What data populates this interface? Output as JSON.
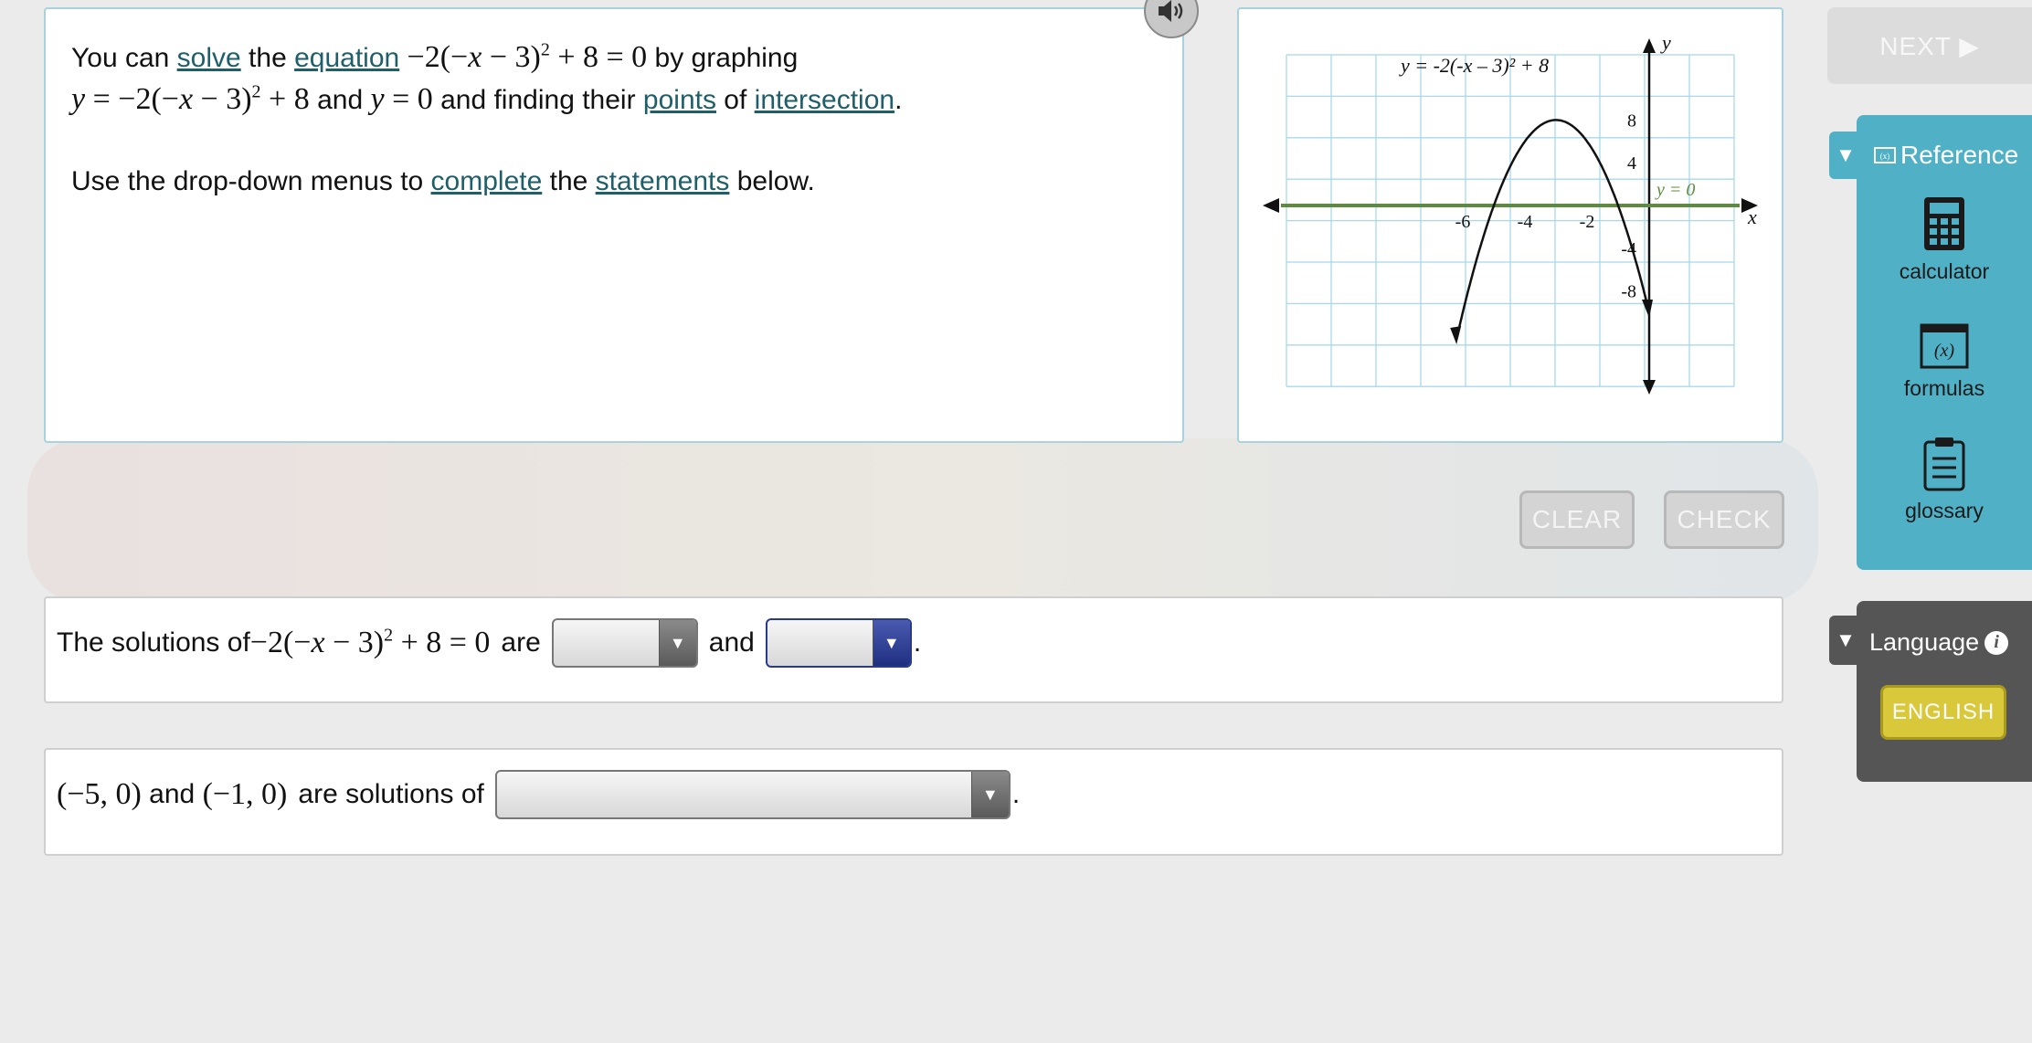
{
  "prompt": {
    "line1": {
      "t1": "You can ",
      "solve": "solve",
      "t2": " the ",
      "equation": "equation",
      "m_a": "−2(−",
      "m_x": "x",
      "m_b": " − 3)",
      "m_sup": "2",
      "m_c": " + 8 = 0",
      "t3": " by graphing"
    },
    "line2": {
      "m1_y": "y",
      "m1_a": " = −2(−",
      "m1_x": "x",
      "m1_b": " − 3)",
      "m1_sup": "2",
      "m1_c": " + 8",
      "t1": " and ",
      "m2_y": "y",
      "m2_a": " = 0",
      "t2": " and finding their ",
      "points": "points",
      "t3": " of ",
      "intersection": "intersection",
      "t4": "."
    },
    "line3": {
      "t1": "Use the drop-down menus to ",
      "complete": "complete",
      "t2": " the ",
      "statements": "statements",
      "t3": " below."
    }
  },
  "graph": {
    "curve_label": "y = -2(-x – 3)² + 8",
    "line_label": "y = 0",
    "x_axis_label": "x",
    "y_axis_label": "y",
    "x_ticks": [
      "-6",
      "-4",
      "-2"
    ],
    "y_ticks": [
      "8",
      "4",
      "-4",
      "-8"
    ],
    "colors": {
      "grid": "#a8d8ea",
      "curve": "#111111",
      "line": "#5e8c3e",
      "axis": "#111111"
    }
  },
  "chart_data": {
    "type": "line",
    "xlabel": "x",
    "ylabel": "y",
    "xlim": [
      -8,
      4
    ],
    "ylim": [
      -10,
      10
    ],
    "grid": true,
    "series": [
      {
        "name": "y = -2(-x – 3)² + 8",
        "function": "-2(-x-3)^2+8",
        "color": "#111111"
      },
      {
        "name": "y = 0",
        "function": "0",
        "color": "#5e8c3e"
      }
    ]
  },
  "buttons": {
    "clear": "CLEAR",
    "check": "CHECK",
    "next": "NEXT ▶"
  },
  "answer1": {
    "t1": "The solutions of ",
    "m_a": "−2(−",
    "m_x": "x",
    "m_b": " − 3)",
    "m_sup": "2",
    "m_c": " + 8 = 0",
    "t2": " are",
    "t3": "and",
    "t4": ".",
    "dropdown1_value": "",
    "dropdown2_value": ""
  },
  "answer2": {
    "m1": "(−5, 0)",
    "t1": " and ",
    "m2": "(−1, 0)",
    "t2": " are solutions of",
    "t3": ".",
    "dropdown_value": ""
  },
  "sidebar": {
    "reference_title": "Reference",
    "tools": [
      {
        "label": "calculator",
        "icon": "calculator-icon"
      },
      {
        "label": "formulas",
        "icon": "formulas-icon"
      },
      {
        "label": "glossary",
        "icon": "glossary-icon"
      }
    ],
    "language_title": "Language",
    "language_button": "ENGLISH"
  }
}
